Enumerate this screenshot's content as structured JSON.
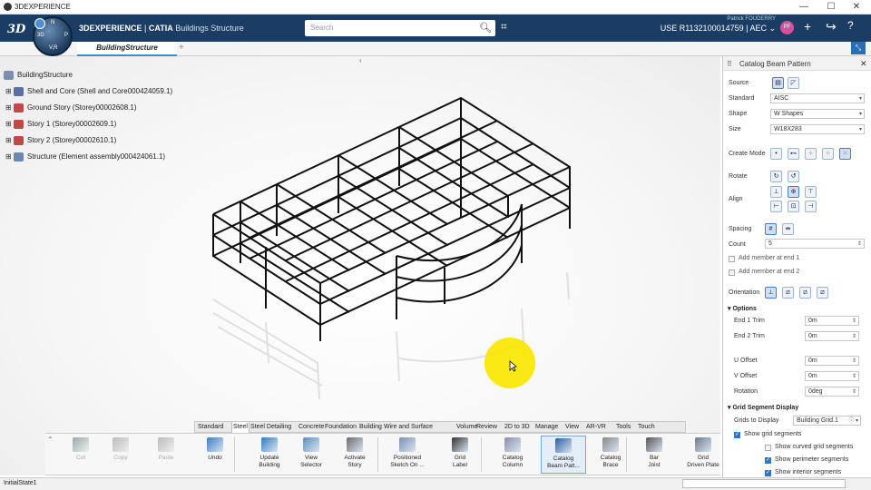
{
  "window": {
    "title": "3DEXPERIENCE",
    "min": "—",
    "max": "☐",
    "close": "✕"
  },
  "header": {
    "brand_logo": "3DS",
    "app_name": "3DEXPERIENCE",
    "app_sep": " | ",
    "app_product": "CATIA",
    "app_sub": " Buildings Structure",
    "compass": {
      "n": "N",
      "v": "V",
      "r": "V,R",
      "p": "P",
      "d3": "3D"
    },
    "search_placeholder": "Search",
    "user_name": "Patrick FOUDERRY",
    "user_role": "USE R1132100014759 | AEC ⌄",
    "avatar_initials": "PF",
    "icons": [
      "search-icon",
      "tag-icon",
      "add-icon",
      "share-icon",
      "help-icon"
    ]
  },
  "tabs": {
    "active": "BuildingStructure",
    "add": "+"
  },
  "tree": {
    "root": "BuildingStructure",
    "items": [
      "Shell and Core (Shell and Core000424059.1)",
      "Ground Story (Storey00002608.1)",
      "Story 1 (Storey00002609.1)",
      "Story 2 (Storey00002610.1)",
      "Structure (Element assembly000424061.1)"
    ]
  },
  "panel": {
    "title": "Catalog Beam Pattern",
    "close": "✕",
    "source": "Source",
    "standard_label": "Standard",
    "standard_value": "AISC",
    "shape_label": "Shape",
    "shape_value": "W Shapes",
    "size_label": "Size",
    "size_value": "W18X283",
    "create_mode": "Create Mode",
    "rotate": "Rotate",
    "align": "Align",
    "spacing": "Spacing",
    "count_label": "Count",
    "count_value": "5",
    "add_start": "Add member at end 1",
    "add_end": "Add member at end 2",
    "orientation": "Orientation",
    "options": "Options",
    "end1_trim": "End 1 Trim",
    "end1_val": "0m",
    "end2_trim": "End 2 Trim",
    "end2_val": "0m",
    "u_offset": "U Offset",
    "u_val": "0m",
    "v_offset": "V Offset",
    "v_val": "0m",
    "rotation": "Rotation",
    "rotation_val": "0deg",
    "grid_seg": "Grid Segment Display",
    "grids_to_display": "Grids to Display",
    "grids_val": "Building Grid.1",
    "show_grid_segments": "Show grid segments",
    "show_curved": "Show curved grid segments",
    "show_perimeter": "Show perimeter segments",
    "show_interior": "Show interior segments",
    "checks": {
      "add_start": false,
      "add_end": false,
      "show_grid_segments": true,
      "show_curved": false,
      "show_perimeter": true,
      "show_interior": true
    }
  },
  "ribbon_tabs": [
    "Standard",
    "Steel",
    "Steel Detailing",
    "Concrete",
    "Foundation",
    "Building",
    "Wire and Surface",
    "Volume",
    "Review",
    "2D to 3D",
    "Manage",
    "View",
    "AR-VR",
    "Tools",
    "Touch"
  ],
  "active_ribbon_tab": "Steel",
  "tools": [
    {
      "l1": "Cut",
      "l2": "",
      "enabled": false,
      "icon": "scissors-icon"
    },
    {
      "l1": "Copy",
      "l2": "",
      "enabled": false,
      "icon": "copy-icon"
    },
    {
      "l1": "Paste",
      "l2": "",
      "enabled": false,
      "icon": "paste-icon"
    },
    {
      "l1": "Undo",
      "l2": "",
      "enabled": true,
      "icon": "undo-icon"
    },
    {
      "l1": "Update",
      "l2": "Building",
      "enabled": true,
      "icon": "update-icon"
    },
    {
      "l1": "View",
      "l2": "Selector",
      "enabled": true,
      "icon": "cube-icon"
    },
    {
      "l1": "Activate",
      "l2": "Story",
      "enabled": true,
      "icon": "stack-icon"
    },
    {
      "l1": "Positioned",
      "l2": "Sketch On ...",
      "enabled": true,
      "icon": "sketch-icon"
    },
    {
      "l1": "Grid",
      "l2": "Label",
      "enabled": true,
      "icon": "grid-label-icon"
    },
    {
      "l1": "Catalog",
      "l2": "Column",
      "enabled": true,
      "icon": "column-icon"
    },
    {
      "l1": "Catalog",
      "l2": "Beam Patt...",
      "enabled": true,
      "icon": "beam-pattern-icon"
    },
    {
      "l1": "Catalog",
      "l2": "Brace",
      "enabled": true,
      "icon": "brace-icon"
    },
    {
      "l1": "Bar",
      "l2": "Joist",
      "enabled": true,
      "icon": "joist-icon"
    },
    {
      "l1": "Grid",
      "l2": "Driven Plate",
      "enabled": true,
      "icon": "plate-icon"
    }
  ],
  "status": "InitialState1"
}
